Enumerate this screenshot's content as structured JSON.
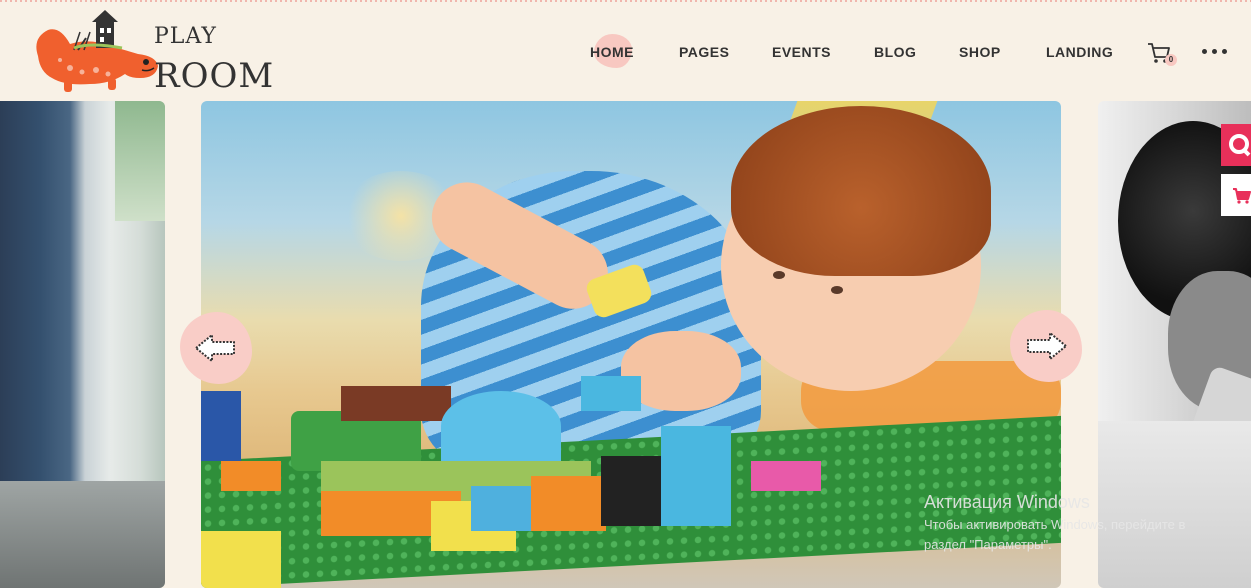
{
  "logo": {
    "line1": "PLAY",
    "line2": "ROOM"
  },
  "nav": {
    "items": [
      {
        "label": "HOME",
        "active": true
      },
      {
        "label": "PAGES"
      },
      {
        "label": "EVENTS"
      },
      {
        "label": "BLOG"
      },
      {
        "label": "SHOP"
      },
      {
        "label": "LANDING"
      }
    ],
    "cart_count": "0"
  },
  "slider": {
    "prev_icon": "arrow-left-icon",
    "next_icon": "arrow-right-icon"
  },
  "side_buttons": [
    {
      "icon": "search-icon",
      "color": "#e8305a"
    },
    {
      "icon": "cart-icon",
      "color": "#ffffff"
    }
  ],
  "watermark": {
    "line1": "Активация Windows",
    "line2": "Чтобы активировать Windows, перейдите в",
    "line3": "раздел \"Параметры\"."
  },
  "colors": {
    "background": "#f8f1e6",
    "accent_pink": "#f8c8c1",
    "logo_orange": "#f0602e",
    "side_red": "#e8305a"
  }
}
